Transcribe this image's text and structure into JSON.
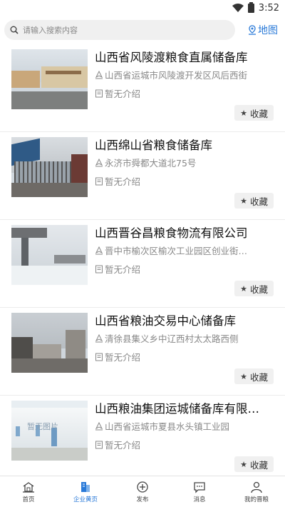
{
  "status_bar": {
    "time": "3:52",
    "icons": [
      "wifi-icon",
      "battery-icon"
    ]
  },
  "search": {
    "placeholder": "请输入搜索内容",
    "icon": "search-icon"
  },
  "map_button": {
    "label": "地图",
    "icon": "map-pin-icon"
  },
  "listings": [
    {
      "title": "山西省风陵渡粮食直属储备库",
      "address": "山西省运城市风陵渡开发区风后西街",
      "intro": "暂无介绍",
      "favorite_label": "收藏"
    },
    {
      "title": "山西绵山省粮食储备库",
      "address": "永济市舜都大道北75号",
      "intro": "暂无介绍",
      "favorite_label": "收藏"
    },
    {
      "title": "山西晋谷昌粮食物流有限公司",
      "address": "晋中市榆次区榆次工业园区创业街…",
      "intro": "暂无介绍",
      "favorite_label": "收藏"
    },
    {
      "title": "山西省粮油交易中心储备库",
      "address": "清徐县集义乡中辽西村太太路西侧",
      "intro": "暂无介绍",
      "favorite_label": "收藏"
    },
    {
      "title": "山西粮油集团运城储备库有限…",
      "address": "山西省运城市夏县水头镇工业园",
      "intro": "暂无介绍",
      "favorite_label": "收藏",
      "image_placeholder": "暂无图片"
    }
  ],
  "bottom_nav": [
    {
      "label": "首页",
      "icon": "home-icon",
      "active": false
    },
    {
      "label": "企业黄页",
      "icon": "yellow-pages-icon",
      "active": true
    },
    {
      "label": "发布",
      "icon": "plus-circle-icon",
      "active": false
    },
    {
      "label": "消息",
      "icon": "message-icon",
      "active": false
    },
    {
      "label": "我的晋粮",
      "icon": "user-icon",
      "active": false
    }
  ],
  "colors": {
    "accent": "#2a7ad8",
    "background": "#ffffff",
    "muted_text": "#888888"
  }
}
